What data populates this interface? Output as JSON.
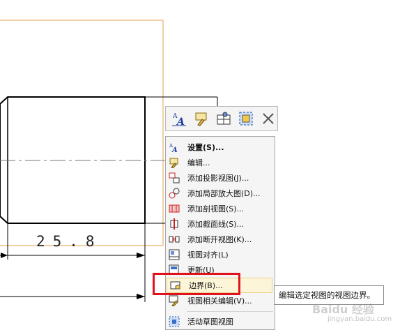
{
  "drawing": {
    "dimension_text": "25.8"
  },
  "mini_toolbar": {
    "buttons": [
      {
        "icon": "text-settings-icon"
      },
      {
        "icon": "edit-icon"
      },
      {
        "icon": "view-grid-icon"
      },
      {
        "icon": "view-boundary-icon"
      },
      {
        "icon": "close-icon"
      }
    ]
  },
  "menu": {
    "items": [
      {
        "label": "设置(S)...",
        "icon": "text-settings-icon"
      },
      {
        "label": "编辑...",
        "icon": "edit-icon"
      },
      {
        "label": "添加投影视图(J)...",
        "icon": "projected-view-icon"
      },
      {
        "label": "添加局部放大图(D)...",
        "icon": "detail-view-icon"
      },
      {
        "label": "添加剖视图(S)...",
        "icon": "section-view-icon"
      },
      {
        "label": "添加截面线(S)...",
        "icon": "section-line-icon"
      },
      {
        "label": "添加断开视图(K)...",
        "icon": "break-view-icon"
      },
      {
        "label": "视图对齐(L)",
        "icon": "align-view-icon"
      },
      {
        "label": "更新(U)",
        "icon": "update-icon"
      },
      {
        "label": "边界(B)...",
        "icon": "boundary-icon"
      },
      {
        "label": "视图相关编辑(V)...",
        "icon": "view-dependent-edit-icon"
      },
      {
        "label": "活动草图视图",
        "icon": "active-sketch-view-icon"
      }
    ]
  },
  "tooltip": {
    "text": "编辑选定视图的视图边界。"
  },
  "watermark": {
    "text": "Baidu 经验",
    "sub": "jingyan.baidu.com"
  },
  "colors": {
    "boundary_orange": "#e3a24a",
    "highlight_red": "#e2121c",
    "menu_bg": "#f5f5f5",
    "hover_bg": "#fdf5d7"
  }
}
